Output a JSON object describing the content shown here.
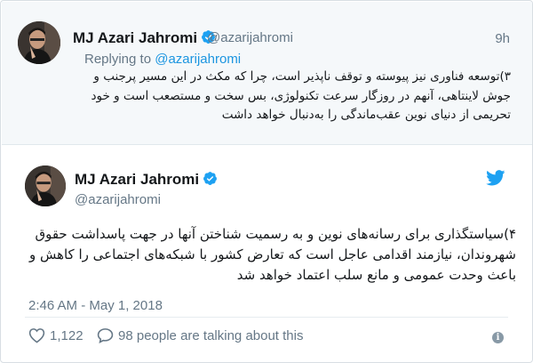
{
  "parent_tweet": {
    "name": "MJ Azari Jahromi",
    "handle": "@azarijahromi",
    "time": "9h",
    "replying_prefix": "Replying to ",
    "replying_handle": "@azarijahromi",
    "text": "۳)توسعه فناوری نیز پیوسته و توقف ناپذیر است، چرا که مکث در این مسیر پرجنب و جوش لاینتاهی، آنهم در روزگار سرعت تکنولوژی، بس سخت و مستصعب است و خود تحریمی از دنیای نوین عقب‌ماندگی را به‌دنبال خواهد داشت"
  },
  "main_tweet": {
    "name": "MJ Azari Jahromi",
    "handle": "@azarijahromi",
    "text": "۴)سیاستگذاری برای رسانه‌های نوین و به رسمیت شناختن آنها در جهت پاسداشت حقوق شهروندان، نیازمند اقدامی عاجل است که تعارض کشور با شبکه‌های اجتماعی را کاهش و باعث وحدت عمومی و مانع سلب اعتماد خواهد شد",
    "timestamp": "2:46 AM - May 1, 2018"
  },
  "footer": {
    "likes_count": "1,122",
    "talking_text": "98 people are talking about this",
    "info_glyph": "i"
  },
  "icons": {
    "verified": "verified-badge-icon",
    "bird": "twitter-bird-icon",
    "heart": "heart-icon",
    "reply": "reply-bubble-icon",
    "info": "info-icon"
  },
  "colors": {
    "link": "#1b95e0",
    "verified": "#1da1f2",
    "muted": "#657786",
    "parent_bg": "#f5f8fa"
  }
}
